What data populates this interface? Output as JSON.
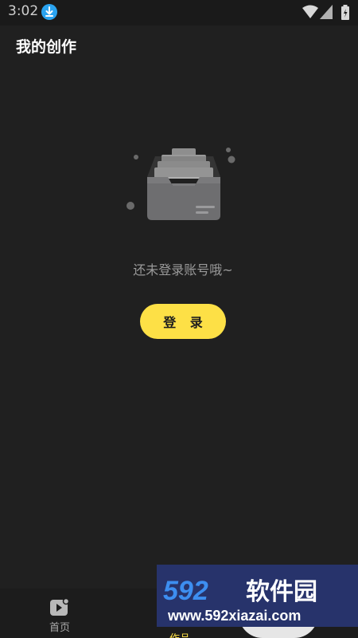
{
  "status_bar": {
    "time": "3:02",
    "icons": [
      "download-icon",
      "wifi-icon",
      "signal-icon",
      "battery-icon"
    ]
  },
  "header": {
    "title": "我的创作"
  },
  "empty_state": {
    "icon": "empty-inbox-icon",
    "message": "还未登录账号哦~",
    "login_button_label": "登 录"
  },
  "bottom_nav": {
    "items": [
      {
        "label": "首页",
        "icon": "video-home-icon"
      },
      {
        "label": "作品",
        "icon": "works-icon",
        "active": true
      }
    ]
  },
  "watermark": {
    "brand_text": "592软件园",
    "url_text": "www.592xiazai.com"
  },
  "colors": {
    "background": "#202020",
    "accent": "#fde046",
    "watermark_bg": "#27336b",
    "download_badge": "#2aa3f0"
  }
}
